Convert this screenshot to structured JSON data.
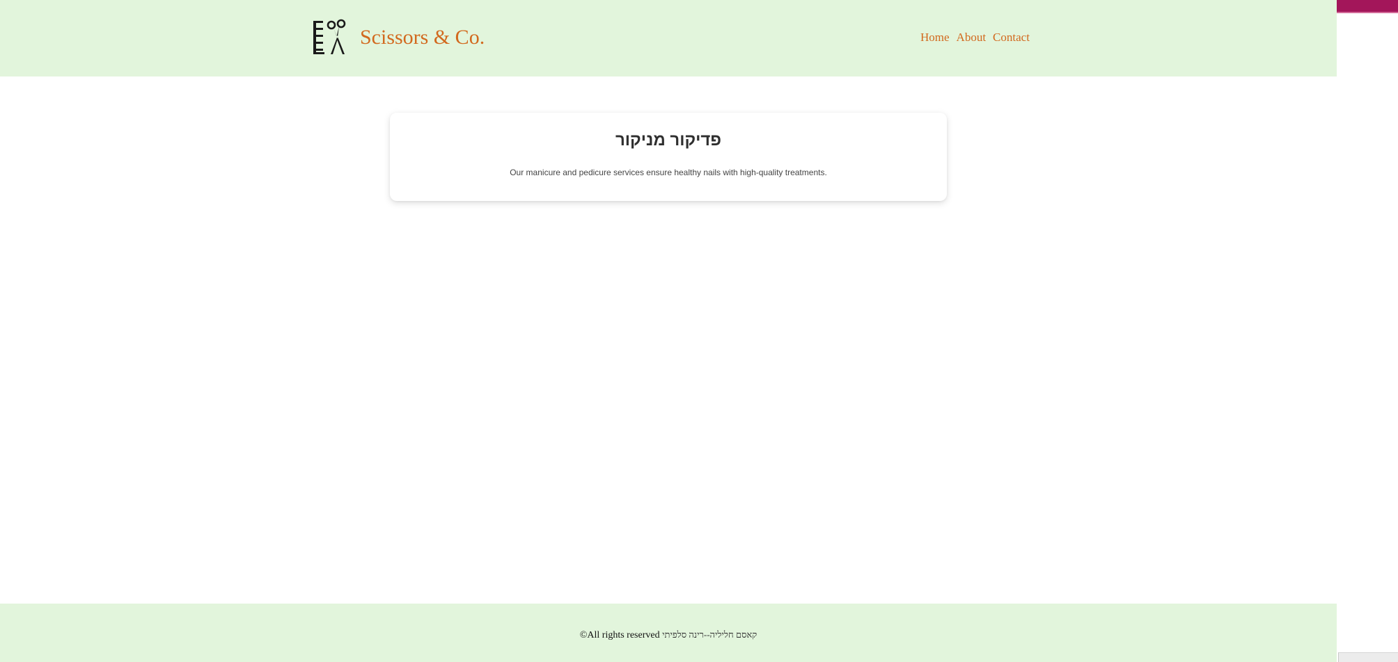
{
  "header": {
    "brand_name": "Scissors & Co.",
    "logo_icon": "comb-and-scissors-icon",
    "nav": [
      {
        "label": "Home"
      },
      {
        "label": "About"
      },
      {
        "label": "Contact"
      }
    ]
  },
  "card": {
    "title": "פדיקור מניקור",
    "text": "Our manicure and pedicure services ensure healthy nails with high-quality treatments."
  },
  "footer": {
    "copyright": "©All rights reserved",
    "credit": "קאסם חליליה--רינה סלפיתי"
  },
  "colors": {
    "header_bg": "#e2f5dc",
    "brand": "#d2691e",
    "accent_strip": "#a3165a"
  }
}
